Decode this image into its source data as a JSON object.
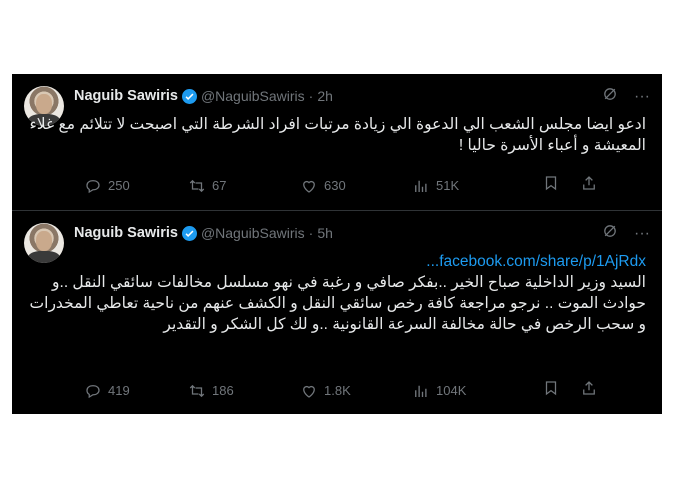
{
  "tweets": [
    {
      "name": "Naguib Sawiris",
      "handle": "@NaguibSawiris",
      "separator": "·",
      "time": "2h",
      "link": "",
      "text": "ادعو ايضا مجلس الشعب الي الدعوة الي زيادة مرتبات افراد الشرطة التي اصبحت لا تتلائم مع غلاء المعيشة و أعباء الأسرة حاليا !",
      "replies": "250",
      "retweets": "67",
      "likes": "630",
      "views": "51K"
    },
    {
      "name": "Naguib Sawiris",
      "handle": "@NaguibSawiris",
      "separator": "·",
      "time": "5h",
      "link": "...facebook.com/share/p/1AjRdx",
      "text": "السيد وزير الداخلية صباح الخير ..بفكر صافي و رغبة في نهو مسلسل مخالفات سائقي النقل ..و حوادث الموت .. نرجو مراجعة كافة رخص سائقي النقل و الكشف عنهم من ناحية تعاطي المخدرات و سحب الرخص في حالة مخالفة السرعة القانونية ..و لك كل الشكر و التقدير",
      "replies": "419",
      "retweets": "186",
      "likes": "1.8K",
      "views": "104K"
    }
  ],
  "icons": {
    "verified": "verified-badge-icon",
    "grok": "grok-icon",
    "more": "more-icon",
    "reply": "reply-icon",
    "retweet": "retweet-icon",
    "like": "like-icon",
    "views": "views-icon",
    "bookmark": "bookmark-icon",
    "share": "share-icon"
  },
  "colors": {
    "background": "#000000",
    "text": "#e7e9ea",
    "secondary": "#71767b",
    "accent": "#1d9bf0"
  }
}
